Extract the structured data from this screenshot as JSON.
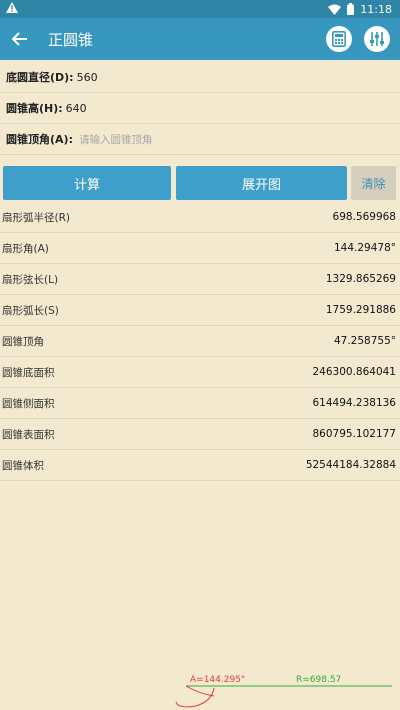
{
  "status": {
    "time": "11:18"
  },
  "appbar": {
    "title": "正圆锥"
  },
  "inputs": [
    {
      "label": "底圆直径(D):",
      "value": "560"
    },
    {
      "label": "圆锥高(H):",
      "value": "640"
    },
    {
      "label": "圆锥顶角(A):",
      "placeholder": "请输入圆锥顶角"
    }
  ],
  "buttons": {
    "calc": "计算",
    "expand": "展开图",
    "clear": "清除"
  },
  "results": [
    {
      "label": "扇形弧半径(R)",
      "value": "698.569968"
    },
    {
      "label": "扇形角(A)",
      "value": "144.29478°"
    },
    {
      "label": "扇形弦长(L)",
      "value": "1329.865269"
    },
    {
      "label": "扇形弧长(S)",
      "value": "1759.291886"
    },
    {
      "label": "圆锥顶角",
      "value": "47.258755°"
    },
    {
      "label": "圆锥底面积",
      "value": "246300.864041"
    },
    {
      "label": "圆锥侧面积",
      "value": "614494.238136"
    },
    {
      "label": "圆锥表面积",
      "value": "860795.102177"
    },
    {
      "label": "圆锥体积",
      "value": "52544184.32884"
    }
  ],
  "diagram": {
    "angle_label": "A=144.295°",
    "radius_label": "R=698.57"
  },
  "colors": {
    "primary": "#3797bf",
    "background": "#f3e9cf",
    "accent_red": "#e53b3b",
    "accent_green": "#2fae3a"
  }
}
